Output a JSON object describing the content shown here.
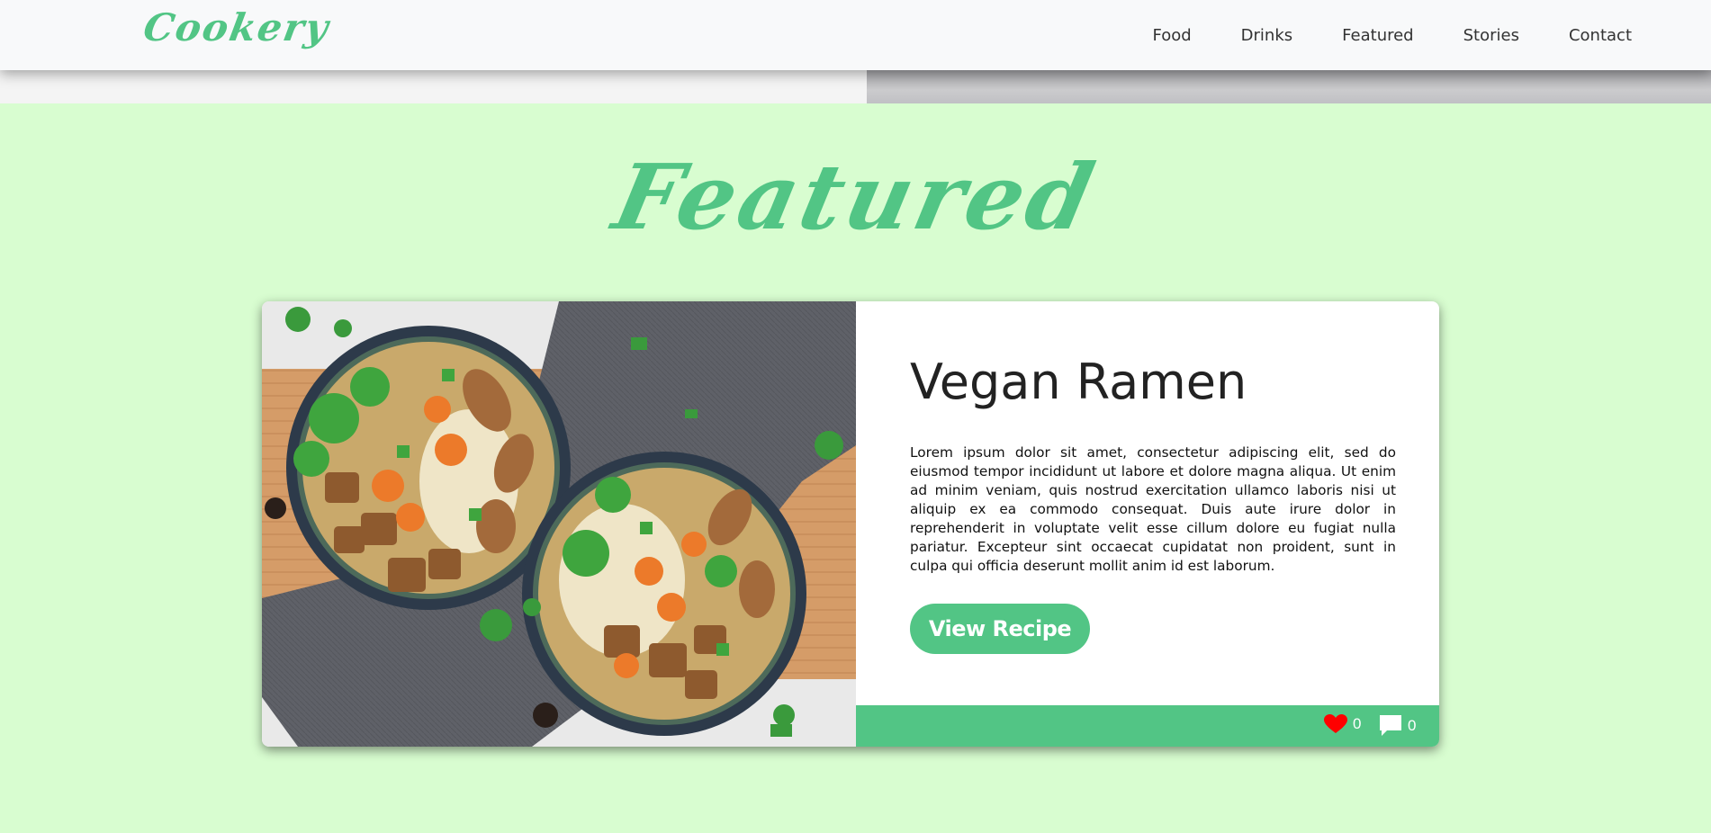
{
  "brand": "Cookery",
  "nav": {
    "items": [
      {
        "label": "Food"
      },
      {
        "label": "Drinks"
      },
      {
        "label": "Featured"
      },
      {
        "label": "Stories"
      },
      {
        "label": "Contact"
      }
    ]
  },
  "section": {
    "title": "Featured"
  },
  "card": {
    "title": "Vegan Ramen",
    "text": "Lorem ipsum dolor sit amet, consectetur adipiscing elit, sed do eiusmod tempor incididunt ut labore et dolore magna aliqua. Ut enim ad minim veniam, quis nostrud exercitation ullamco laboris nisi ut aliquip ex ea commodo consequat. Duis aute irure dolor in reprehenderit in voluptate velit esse cillum dolore eu fugiat nulla pariatur. Excepteur sint occaecat cupidatat non proident, sunt in culpa qui officia deserunt mollit anim id est laborum.",
    "button": "View Recipe",
    "likes": "0",
    "comments": "0",
    "like_icon": "heart-icon",
    "comment_icon": "comment-icon"
  },
  "colors": {
    "accent": "#52c585",
    "background": "#d8fdd0",
    "like": "#ff0000"
  }
}
